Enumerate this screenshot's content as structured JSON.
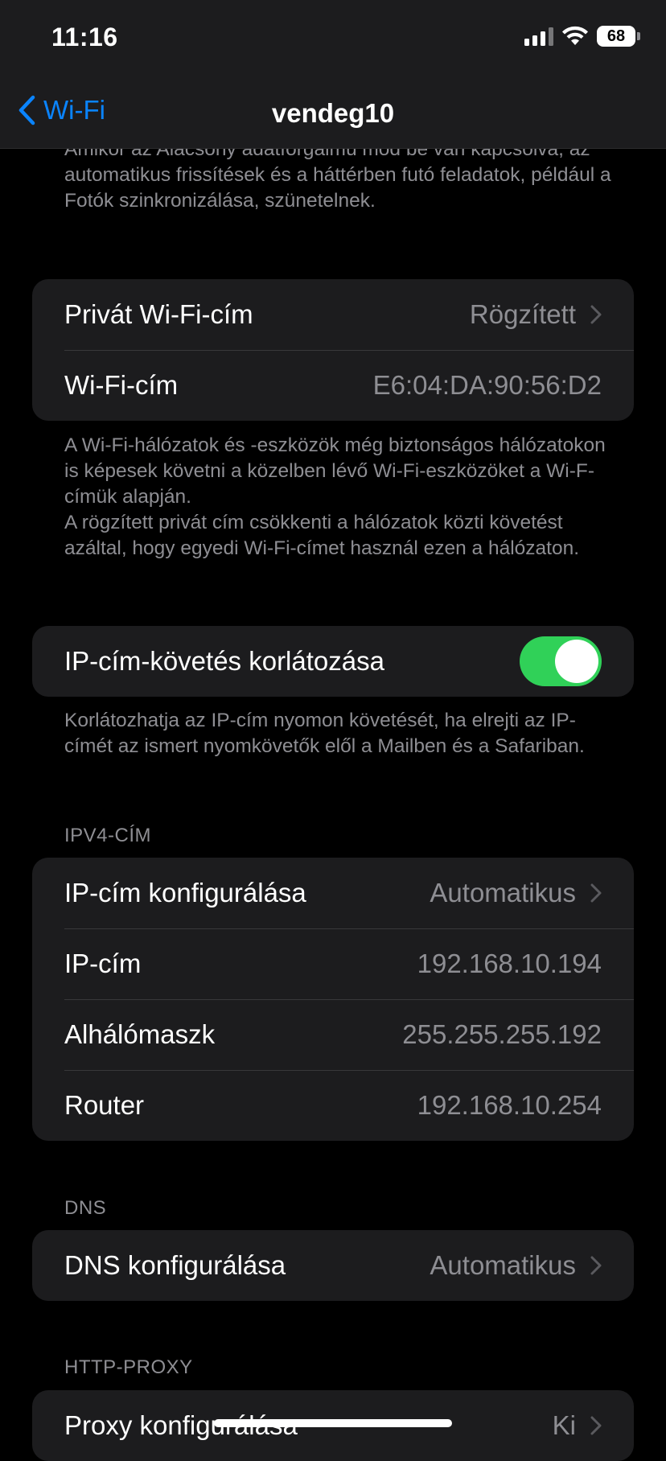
{
  "status_bar": {
    "time": "11:16",
    "battery_level": "68",
    "icons": [
      "cellular-signal-icon",
      "wifi-icon",
      "battery-icon"
    ]
  },
  "nav": {
    "back_label": "Wi-Fi",
    "title": "vendeg10",
    "accent_color": "#0a84ff"
  },
  "low_data_footer": "Amikor az Alacsony adatforgalmú mód be van kapcsolva, az automatikus frissítések és a háttérben futó feladatok, például a Fotók szinkronizálása, szünetelnek.",
  "private_address": {
    "rows": [
      {
        "label": "Privát Wi-Fi-cím",
        "value": "Rögzített"
      },
      {
        "label": "Wi-Fi-cím",
        "value": "E6:04:DA:90:56:D2"
      }
    ],
    "footer_line1": "A Wi-Fi-hálózatok és -eszközök még biztonságos hálózatokon is képesek követni a közelben lévő Wi-Fi-eszközöket a Wi-F-címük alapján.",
    "footer_line2": "A rögzített privát cím csökkenti a hálózatok közti követést azáltal, hogy egyedi Wi-Fi-címet használ ezen a hálózaton."
  },
  "ip_tracking": {
    "label": "IP-cím-követés korlátozása",
    "enabled": true,
    "toggle_color": "#30d158",
    "footer": "Korlátozhatja az IP-cím nyomon követését, ha elrejti az IP-címét az ismert nyomkövetők elől a Mailben és a Safariban."
  },
  "ipv4": {
    "header": "IPV4-CÍM",
    "rows": [
      {
        "label": "IP-cím konfigurálása",
        "value": "Automatikus"
      },
      {
        "label": "IP-cím",
        "value": "192.168.10.194"
      },
      {
        "label": "Alhálómaszk",
        "value": "255.255.255.192"
      },
      {
        "label": "Router",
        "value": "192.168.10.254"
      }
    ]
  },
  "dns": {
    "header": "DNS",
    "row": {
      "label": "DNS konfigurálása",
      "value": "Automatikus"
    }
  },
  "http_proxy": {
    "header": "HTTP-PROXY",
    "row": {
      "label": "Proxy konfigurálása",
      "value": "Ki"
    }
  }
}
